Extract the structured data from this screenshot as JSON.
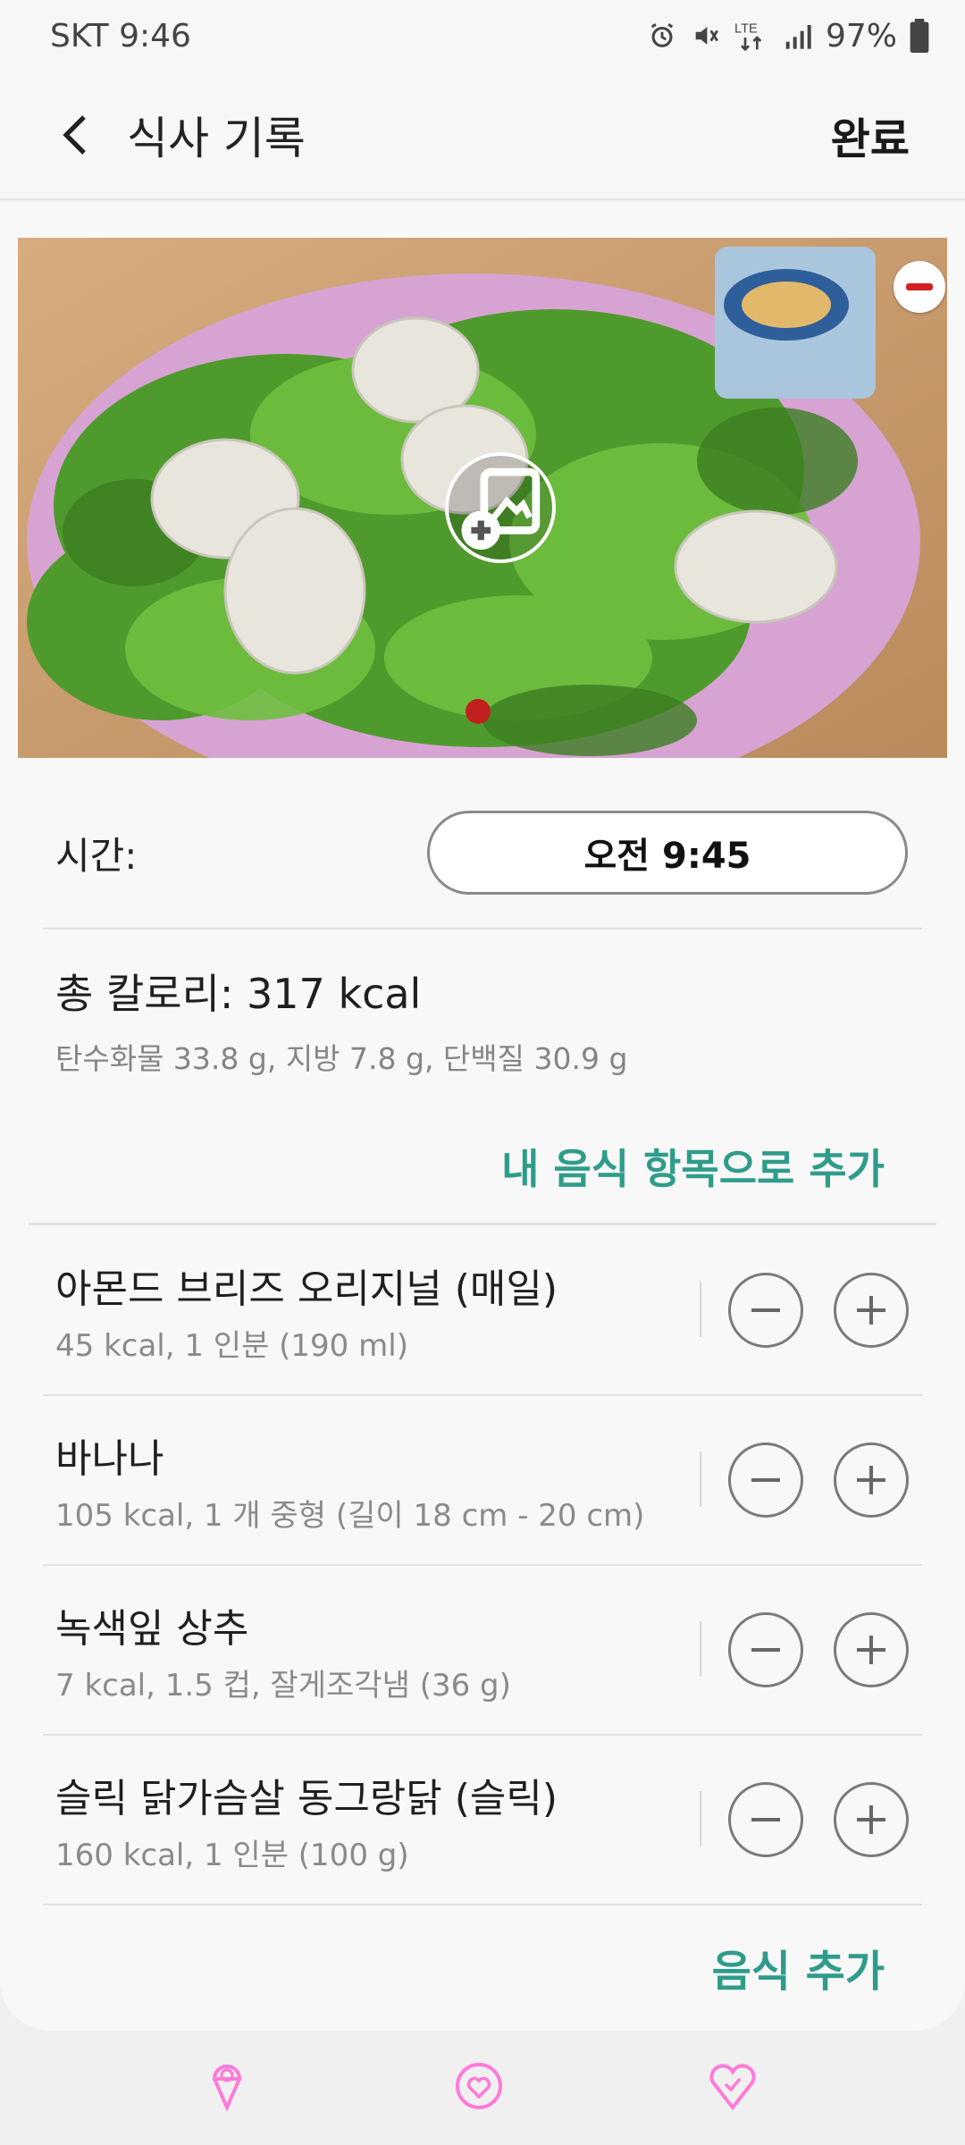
{
  "status_bar": {
    "carrier_time": "SKT 9:46",
    "network": "LTE",
    "battery": "97%",
    "icons": [
      "alarm-icon",
      "vibrate-icon",
      "lte-icon",
      "signal-icon",
      "battery-icon"
    ]
  },
  "header": {
    "title": "식사 기록",
    "done_label": "완료"
  },
  "time": {
    "label": "시간:",
    "value": "오전 9:45"
  },
  "summary": {
    "total": "총 칼로리: 317 kcal",
    "macros": "탄수화물 33.8 g, 지방 7.8 g, 단백질 30.9 g"
  },
  "add_to_my_food_label": "내 음식 항목으로 추가",
  "foods": [
    {
      "name": "아몬드 브리즈 오리지널 (매일)",
      "detail": "45 kcal, 1 인분 (190 ml)"
    },
    {
      "name": "바나나",
      "detail": "105 kcal, 1 개 중형 (길이 18 cm - 20 cm)"
    },
    {
      "name": "녹색잎 상추",
      "detail": "7 kcal, 1.5 컵, 잘게조각냄 (36 g)"
    },
    {
      "name": "슬릭 닭가슴살 동그랑닭 (슬릭)",
      "detail": "160 kcal, 1 인분 (100 g)"
    }
  ],
  "add_food_label": "음식 추가",
  "colors": {
    "accent": "#2f9c8a",
    "remove_red": "#d42020",
    "nav_pink": "#ff7ad9"
  },
  "bottom_nav_icons": [
    "ice-cream-icon",
    "heart-icon",
    "heart-shield-icon"
  ]
}
